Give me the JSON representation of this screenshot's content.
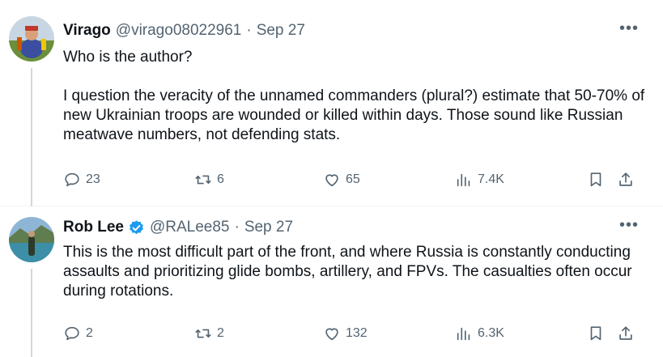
{
  "tweets": [
    {
      "author_name": "Virago",
      "handle": "@virago08022961",
      "date": "Sep 27",
      "text": "Who is the author?\n\nI question the veracity of the unnamed commanders  (plural?) estimate that 50-70% of new Ukrainian troops are wounded or killed within days. Those sound like Russian meatwave numbers, not defending stats.",
      "replies": "23",
      "reposts": "6",
      "likes": "65",
      "views": "7.4K",
      "verified": false
    },
    {
      "author_name": "Rob Lee",
      "handle": "@RALee85",
      "date": "Sep 27",
      "text": "This is the most difficult part of the front, and where Russia is constantly conducting assaults and prioritizing glide bombs, artillery, and FPVs. The casualties often occur during rotations.",
      "replies": "2",
      "reposts": "2",
      "likes": "132",
      "views": "6.3K",
      "verified": true
    }
  ],
  "separator": "·",
  "more_glyph": "•••",
  "colors": {
    "text": "#0f1419",
    "secondary": "#536471",
    "verified": "#1d9bf0",
    "thread_line": "#cfd9de"
  },
  "icons": [
    "reply-icon",
    "repost-icon",
    "like-icon",
    "views-icon",
    "bookmark-icon",
    "share-icon",
    "more-icon",
    "verified-badge-icon"
  ]
}
